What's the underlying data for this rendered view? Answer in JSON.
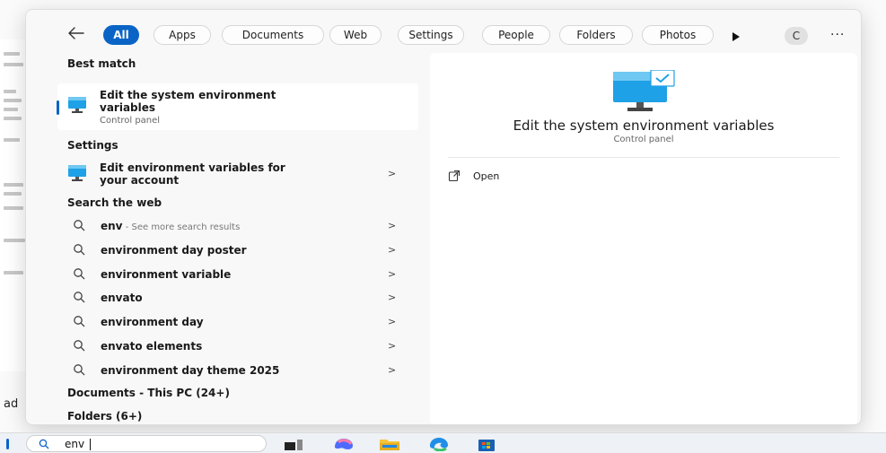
{
  "filters": {
    "back_label": "Back",
    "chips": [
      "All",
      "Apps",
      "Documents",
      "Web",
      "Settings",
      "People",
      "Folders",
      "Photos"
    ],
    "active": "All",
    "avatar_initial": "C",
    "more_label": "..."
  },
  "results": {
    "best_match": {
      "section": "Best match",
      "title_line1": "Edit the system environment",
      "title_line2": "variables",
      "subtitle": "Control panel"
    },
    "settings": {
      "section": "Settings",
      "title_line1": "Edit environment variables for",
      "title_line2": "your account",
      "chevron": ">"
    },
    "web": {
      "section": "Search the web",
      "items": [
        {
          "query": "env",
          "hint": " - See more search results"
        },
        {
          "query": "environment day poster",
          "hint": ""
        },
        {
          "query": "environment variable",
          "hint": ""
        },
        {
          "query": "envato",
          "hint": ""
        },
        {
          "query": "environment day",
          "hint": ""
        },
        {
          "query": "envato elements",
          "hint": ""
        },
        {
          "query": "environment day theme 2025",
          "hint": ""
        }
      ],
      "chevron": ">"
    },
    "documents_section": "Documents - This PC (24+)",
    "folders_section": "Folders (6+)"
  },
  "preview": {
    "title": "Edit the system environment variables",
    "subtitle": "Control panel",
    "action_open": "Open"
  },
  "taskbar": {
    "search_value": "env"
  },
  "background": {
    "partial_text": "ad"
  },
  "colors": {
    "accent": "#0a64c6",
    "monitor_blue": "#1ea1e6"
  }
}
